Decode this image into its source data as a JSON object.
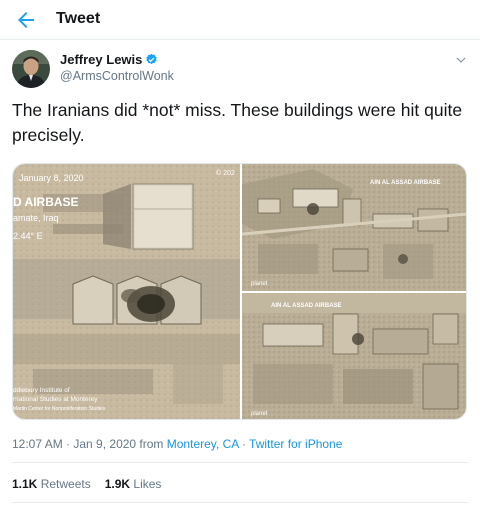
{
  "header": {
    "title": "Tweet",
    "back_icon": "arrow-left-icon"
  },
  "author": {
    "name": "Jeffrey Lewis",
    "handle": "@ArmsControlWonk",
    "verified_icon": "verified-badge-icon",
    "menu_icon": "chevron-down-icon"
  },
  "tweet": {
    "text": "The Iranians did *not* miss. These buildings were hit quite precisely."
  },
  "media": {
    "left_image": {
      "date_label": "January 8, 2020",
      "corner_label": "© 202",
      "site_title": "D AIRBASE",
      "location": "amate, Iraq",
      "coords": "2.44° E",
      "credit_line1": "ddlebury Institute of",
      "credit_line2": "rnational Studies at Monterey",
      "credit_line3": "Martin Center for Nonproliferation Studies"
    },
    "top_right_image": {
      "label": "AIN AL ASSAD AIRBASE",
      "watermark": "planet"
    },
    "bottom_right_image": {
      "label": "AIN AL ASSAD AIRBASE",
      "watermark": "planet"
    }
  },
  "meta": {
    "time": "12:07 AM",
    "separator1": " · ",
    "date": "Jan 9, 2020",
    "from_text": " from ",
    "location_link": "Monterey, CA",
    "separator2": " · ",
    "source_link": "Twitter for iPhone"
  },
  "stats": {
    "retweets_count": "1.1K",
    "retweets_label": " Retweets",
    "likes_count": "1.9K",
    "likes_label": " Likes"
  },
  "colors": {
    "accent": "#1da1f2",
    "link": "#1b95e0",
    "secondary_text": "#657786",
    "primary_text": "#14171a",
    "border": "#e6ecf0"
  }
}
